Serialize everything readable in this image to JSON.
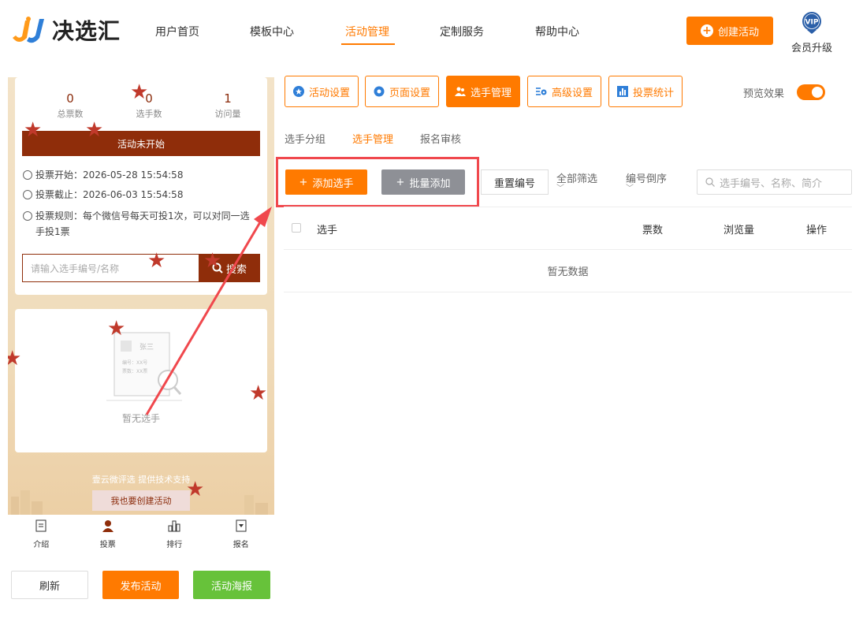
{
  "header": {
    "logo_text": "决选汇",
    "nav": [
      {
        "label": "用户首页"
      },
      {
        "label": "模板中心"
      },
      {
        "label": "活动管理"
      },
      {
        "label": "定制服务"
      },
      {
        "label": "帮助中心"
      }
    ],
    "create_button": "创建活动",
    "vip_badge": "VIP",
    "vip_label": "会员升级"
  },
  "preview": {
    "stats": [
      {
        "value": "0",
        "label": "总票数"
      },
      {
        "value": "0",
        "label": "选手数"
      },
      {
        "value": "1",
        "label": "访问量"
      }
    ],
    "status": "活动未开始",
    "vote_start": "投票开始：2026-05-28 15:54:58",
    "vote_end": "投票截止：2026-06-03 15:54:58",
    "vote_rule": "投票规则：每个微信号每天可投1次，可以对同一选手投1票",
    "search_placeholder": "请输入选手编号/名称",
    "search_button": "搜索",
    "illustration_name": "张三",
    "illustration_line1": "编号：XX号",
    "illustration_line2": "票数：XX票",
    "empty_text": "暂无选手",
    "footer_note": "壹云微评选 提供技术支持",
    "footer_button": "我也要创建活动",
    "tabs": [
      {
        "label": "介绍"
      },
      {
        "label": "投票"
      },
      {
        "label": "排行"
      },
      {
        "label": "报名"
      }
    ]
  },
  "bottom_buttons": {
    "refresh": "刷新",
    "publish": "发布活动",
    "poster": "活动海报"
  },
  "toolbar": {
    "items": [
      {
        "label": "活动设置"
      },
      {
        "label": "页面设置"
      },
      {
        "label": "选手管理"
      },
      {
        "label": "高级设置"
      },
      {
        "label": "投票统计"
      }
    ],
    "preview_label": "预览效果"
  },
  "subtabs": [
    {
      "label": "选手分组"
    },
    {
      "label": "选手管理"
    },
    {
      "label": "报名审核"
    }
  ],
  "actions": {
    "add": "添加选手",
    "batch_add": "批量添加",
    "reset": "重置编号",
    "filter_all": "全部筛选",
    "sort": "编号倒序",
    "search_placeholder": "选手编号、名称、简介"
  },
  "table": {
    "columns": [
      "选手",
      "票数",
      "浏览量",
      "操作"
    ],
    "empty": "暂无数据"
  },
  "colors": {
    "accent": "#ff7a00",
    "brand_dark": "#8f2d0a",
    "highlight_box": "#f0484d",
    "green": "#67c23a"
  }
}
